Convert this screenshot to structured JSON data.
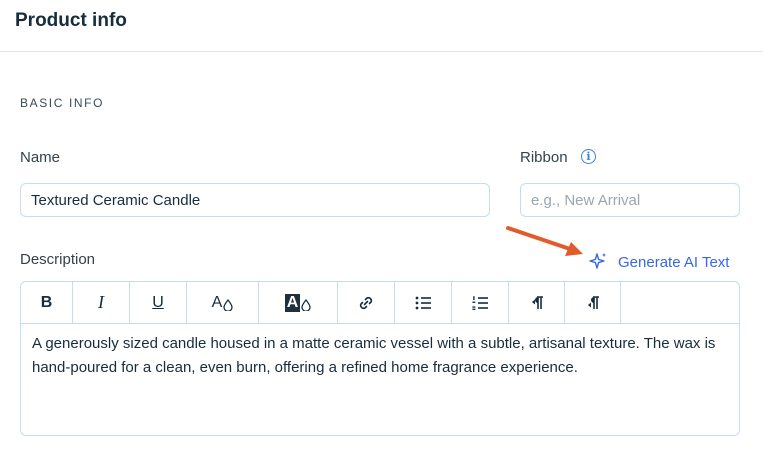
{
  "header": {
    "title": "Product info"
  },
  "section": {
    "title": "BASIC INFO"
  },
  "name": {
    "label": "Name",
    "value": "Textured Ceramic Candle"
  },
  "ribbon": {
    "label": "Ribbon",
    "placeholder": "e.g., New Arrival"
  },
  "description": {
    "label": "Description",
    "generate_label": "Generate AI Text",
    "text": "A generously sized candle housed in a matte ceramic vessel with a subtle, artisanal texture. The wax is hand-poured for a clean, even burn, offering a refined home fragrance experience."
  },
  "toolbar": {
    "bold_label": "B",
    "italic_label": "I",
    "underline_label": "U",
    "text_color_label": "A",
    "highlight_label": "A"
  },
  "colors": {
    "accent": "#3966e8",
    "border": "#c5dcf4",
    "arrow": "#e25b2a"
  }
}
